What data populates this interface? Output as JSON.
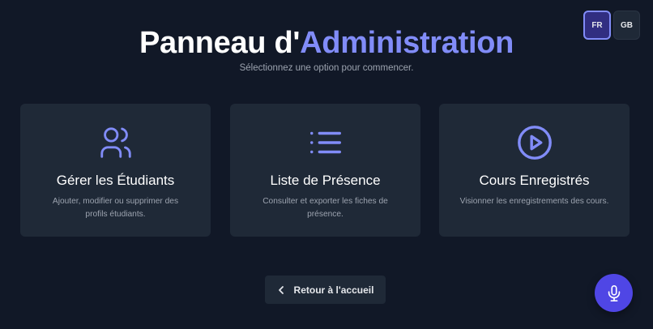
{
  "language": {
    "active": "FR",
    "options": [
      "FR",
      "GB"
    ]
  },
  "header": {
    "title_prefix": "Panneau d'",
    "title_accent": "Administration",
    "subtitle": "Sélectionnez une option pour commencer."
  },
  "cards": [
    {
      "icon": "users-icon",
      "title": "Gérer les Étudiants",
      "description": "Ajouter, modifier ou supprimer des profils étudiants."
    },
    {
      "icon": "list-icon",
      "title": "Liste de Présence",
      "description": "Consulter et exporter les fiches de présence."
    },
    {
      "icon": "play-circle-icon",
      "title": "Cours Enregistrés",
      "description": "Visionner les enregistrements des cours."
    }
  ],
  "back_button": {
    "label": "Retour à l'accueil",
    "icon": "chevron-left-icon"
  },
  "mic_button": {
    "icon": "microphone-icon"
  },
  "colors": {
    "background": "#111827",
    "card": "#1f2937",
    "accent": "#818cf8",
    "mic": "#4f46e5"
  }
}
